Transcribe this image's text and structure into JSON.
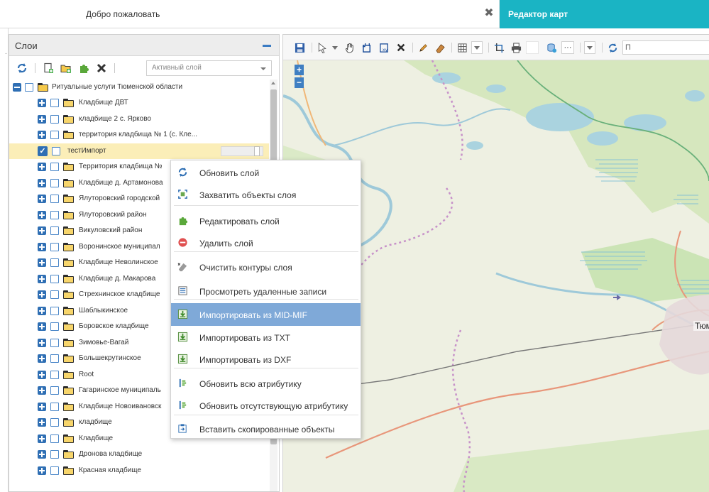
{
  "tabs": {
    "welcome_label": "Добро пожаловать",
    "editor_label": "Редактор карт"
  },
  "layers_panel": {
    "title": "Слои",
    "active_layer_placeholder": "Активный слой"
  },
  "tree": {
    "root_label": "Ритуальные услуги Тюменской области",
    "items": [
      {
        "label": "Кладбище ДВТ"
      },
      {
        "label": "кладбище 2 с. Ярково"
      },
      {
        "label": "территория кладбища № 1 (с. Кле..."
      },
      {
        "label": "тестИмпорт"
      },
      {
        "label": "Территория кладбища №"
      },
      {
        "label": "Кладбище д. Артамонова"
      },
      {
        "label": "Ялуторовский городской"
      },
      {
        "label": "Ялуторовский район"
      },
      {
        "label": "Викуловский район"
      },
      {
        "label": "Воронинское муниципал"
      },
      {
        "label": "Кладбище Неволинское"
      },
      {
        "label": "Кладбище д. Макарова"
      },
      {
        "label": "Стрехнинское кладбище"
      },
      {
        "label": "Шаблыкинское"
      },
      {
        "label": "Боровское кладбище"
      },
      {
        "label": "Зимовье-Вагай"
      },
      {
        "label": "Большекрутинское"
      },
      {
        "label": "Root"
      },
      {
        "label": "Гагаринское муниципаль"
      },
      {
        "label": "Кладбище Новоивановск"
      },
      {
        "label": "кладбище"
      },
      {
        "label": "Кладбище"
      },
      {
        "label": "Дронова кладбище"
      },
      {
        "label": "Красная кладбище"
      }
    ]
  },
  "context_menu": {
    "items": [
      {
        "label": "Обновить слой",
        "icon": "refresh-icon"
      },
      {
        "label": "Захватить объекты слоя",
        "icon": "capture-icon"
      },
      {
        "label": "Редактировать слой",
        "icon": "puzzle-icon"
      },
      {
        "label": "Удалить слой",
        "icon": "delete-icon"
      },
      {
        "label": "Очистить контуры слоя",
        "icon": "clear-icon"
      },
      {
        "label": "Просмотреть удаленные записи",
        "icon": "list-icon"
      },
      {
        "label": "Импортировать из MID-MIF",
        "icon": "import-icon"
      },
      {
        "label": "Импортировать из TXT",
        "icon": "import-icon"
      },
      {
        "label": "Импортировать из DXF",
        "icon": "import-icon"
      },
      {
        "label": "Обновить всю атрибутику",
        "icon": "attr-icon"
      },
      {
        "label": "Обновить отсутствующую атрибутику",
        "icon": "attr-icon"
      },
      {
        "label": "Вставить скопированные объекты",
        "icon": "paste-icon"
      }
    ]
  },
  "map": {
    "city_label": "Тюм",
    "search_value": "П",
    "zoom_in": "+",
    "zoom_out": "−"
  },
  "colors": {
    "accent": "#1ab4c4",
    "tree_blue": "#2f6fb4",
    "highlight": "#7fa9d8",
    "selected_row": "#fbeeb8"
  }
}
